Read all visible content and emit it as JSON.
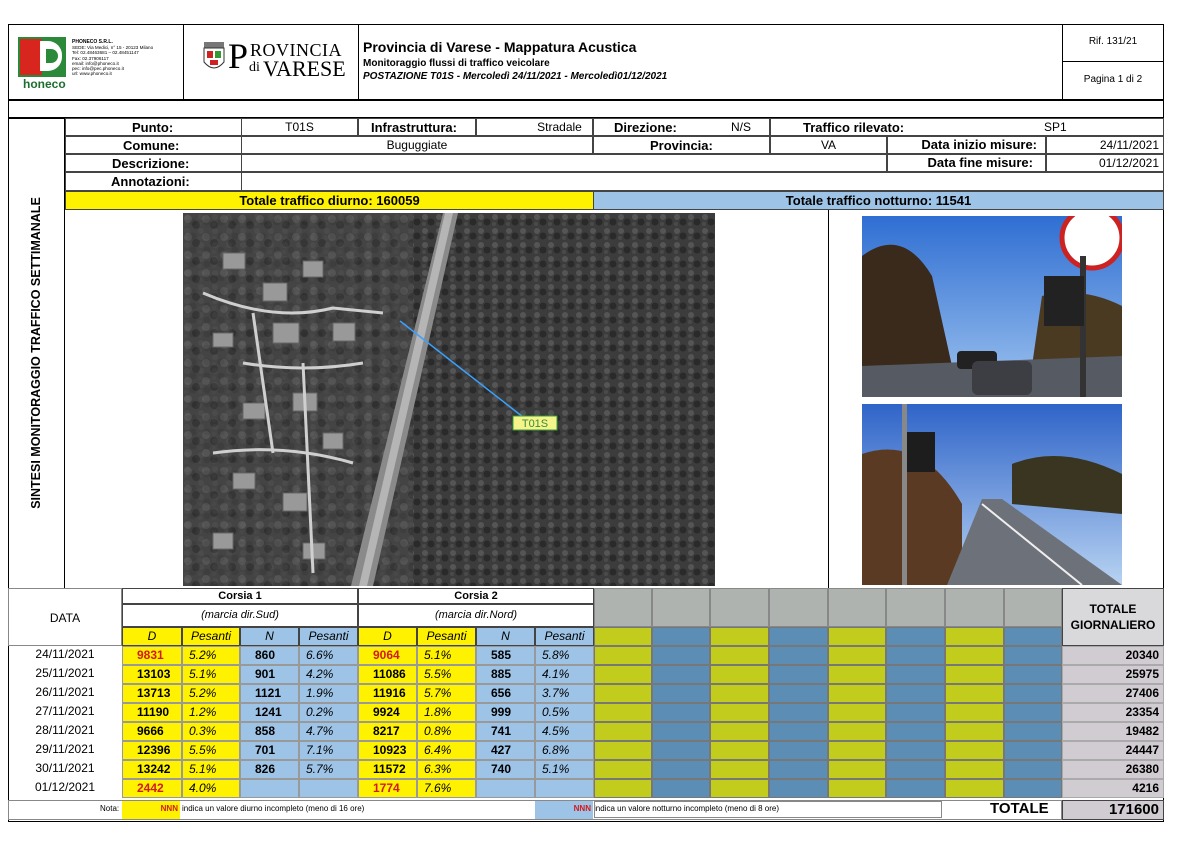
{
  "header": {
    "company": {
      "name": "PHONECO S.R.L.",
      "lines": [
        "SEDE: Via Medici, n° 15 - 20123 Milano",
        "Tel: 02.48463681 – 02.48451147",
        "Fax: 02.37906117",
        "email: info@phoneco.it",
        "pec: info@pec.phoneco.it",
        "url: www.phoneco.it"
      ],
      "logo_text": "honeco"
    },
    "province_logo": {
      "big1": "ROVINCIA",
      "p": "P",
      "di": "di",
      "big2": "VARESE"
    },
    "title": "Provincia di Varese - Mappatura Acustica",
    "subtitle": "Monitoraggio flussi di traffico veicolare",
    "station": "POSTAZIONE T01S - Mercoledì 24/11/2021 - Mercoledì01/12/2021",
    "ref": "Rif. 131/21",
    "page": "Pagina 1 di 2"
  },
  "side_title": "SINTESI MONITORAGGIO TRAFFICO SETTIMANALE",
  "info": {
    "punto_label": "Punto:",
    "punto": "T01S",
    "infra_label": "Infrastruttura:",
    "infra": "Stradale",
    "dir_label": "Direzione:",
    "dir": "N/S",
    "traffico_label": "Traffico rilevato:",
    "traffico": "SP1",
    "comune_label": "Comune:",
    "comune": "Buguggiate",
    "prov_label": "Provincia:",
    "prov": "VA",
    "inizio_label": "Data inizio misure:",
    "inizio": "24/11/2021",
    "fine_label": "Data fine misure:",
    "fine": "01/12/2021",
    "descr_label": "Descrizione:",
    "annot_label": "Annotazioni:"
  },
  "totals": {
    "diurno": "Totale traffico diurno: 160059",
    "notturno": "Totale traffico notturno: 11541"
  },
  "map_marker": "T01S",
  "table": {
    "data_header": "DATA",
    "corsia1": "Corsia 1",
    "corsia1_sub": "(marcia dir.Sud)",
    "corsia2": "Corsia 2",
    "corsia2_sub": "(marcia dir.Nord)",
    "col_d": "D",
    "col_pes": "Pesanti",
    "col_n": "N",
    "tot_header": "TOTALE GIORNALIERO",
    "rows": [
      {
        "date": "24/11/2021",
        "d1": "9831",
        "p1": "5.2%",
        "n1": "860",
        "pn1": "6.6%",
        "d2": "9064",
        "p2": "5.1%",
        "n2": "585",
        "pn2": "5.8%",
        "tot": "20340"
      },
      {
        "date": "25/11/2021",
        "d1": "13103",
        "p1": "5.1%",
        "n1": "901",
        "pn1": "4.2%",
        "d2": "11086",
        "p2": "5.5%",
        "n2": "885",
        "pn2": "4.1%",
        "tot": "25975"
      },
      {
        "date": "26/11/2021",
        "d1": "13713",
        "p1": "5.2%",
        "n1": "1121",
        "pn1": "1.9%",
        "d2": "11916",
        "p2": "5.7%",
        "n2": "656",
        "pn2": "3.7%",
        "tot": "27406"
      },
      {
        "date": "27/11/2021",
        "d1": "11190",
        "p1": "1.2%",
        "n1": "1241",
        "pn1": "0.2%",
        "d2": "9924",
        "p2": "1.8%",
        "n2": "999",
        "pn2": "0.5%",
        "tot": "23354"
      },
      {
        "date": "28/11/2021",
        "d1": "9666",
        "p1": "0.3%",
        "n1": "858",
        "pn1": "4.7%",
        "d2": "8217",
        "p2": "0.8%",
        "n2": "741",
        "pn2": "4.5%",
        "tot": "19482"
      },
      {
        "date": "29/11/2021",
        "d1": "12396",
        "p1": "5.5%",
        "n1": "701",
        "pn1": "7.1%",
        "d2": "10923",
        "p2": "6.4%",
        "n2": "427",
        "pn2": "6.8%",
        "tot": "24447"
      },
      {
        "date": "30/11/2021",
        "d1": "13242",
        "p1": "5.1%",
        "n1": "826",
        "pn1": "5.7%",
        "d2": "11572",
        "p2": "6.3%",
        "n2": "740",
        "pn2": "5.1%",
        "tot": "26380"
      },
      {
        "date": "01/12/2021",
        "d1": "2442",
        "p1": "4.0%",
        "n1": "",
        "pn1": "",
        "d2": "1774",
        "p2": "7.6%",
        "n2": "",
        "pn2": "",
        "tot": "4216"
      }
    ],
    "red_rows_d": [
      0,
      7
    ]
  },
  "footer": {
    "nota": "Nota:",
    "nnn": "NNN",
    "diurno_note": "indica un valore diurno incompleto (meno di 16 ore)",
    "notturno_note": "indica un valore notturno incompleto (meno di 8 ore)",
    "totale_label": "TOTALE",
    "totale": "171600"
  }
}
